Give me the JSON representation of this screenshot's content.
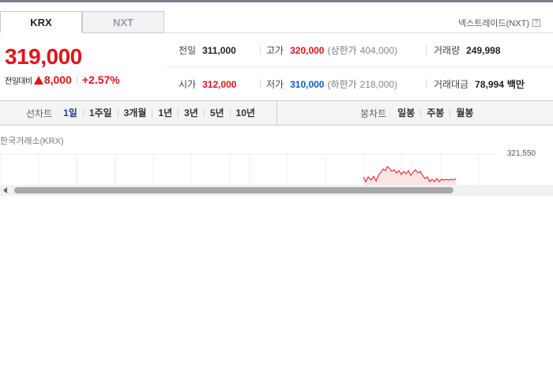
{
  "tabs": [
    {
      "label": "KRX",
      "active": true
    },
    {
      "label": "NXT",
      "active": false
    }
  ],
  "nxt_link": {
    "label": "넥스트레이드(NXT)",
    "icon": "help-icon",
    "icon_glyph": "?"
  },
  "quote": {
    "price": "319,000",
    "change_label": "전일대비",
    "change_icon": "up-triangle-icon",
    "change_value": "8,000",
    "change_percent": "+2.57%",
    "up_color": "#e5121b",
    "down_color": "#1259d4"
  },
  "stats": {
    "prev_close": {
      "label": "전일",
      "value": "311,000"
    },
    "high": {
      "label": "고가",
      "value": "320,000",
      "sub_label": "(상한가",
      "sub_value": "404,000)"
    },
    "volume": {
      "label": "거래량",
      "value": "249,998"
    },
    "open": {
      "label": "시가",
      "value": "312,000"
    },
    "low": {
      "label": "저가",
      "value": "310,000",
      "sub_label": "(하한가",
      "sub_value": "218,000)"
    },
    "amount": {
      "label": "거래대금",
      "value": "78,994",
      "unit": "백만"
    }
  },
  "line_chart_nav": {
    "title": "선차트",
    "items": [
      "1일",
      "1주일",
      "3개월",
      "1년",
      "3년",
      "5년",
      "10년"
    ],
    "active_index": 0
  },
  "candle_chart_nav": {
    "title": "봉차트",
    "items": [
      "일봉",
      "주봉",
      "월봉"
    ]
  },
  "chart": {
    "exchange_label": "한국거래소(KRX)",
    "y_top_label": "321,550",
    "line_color": "#e5121b",
    "fill_color": "#fde4e5"
  }
}
